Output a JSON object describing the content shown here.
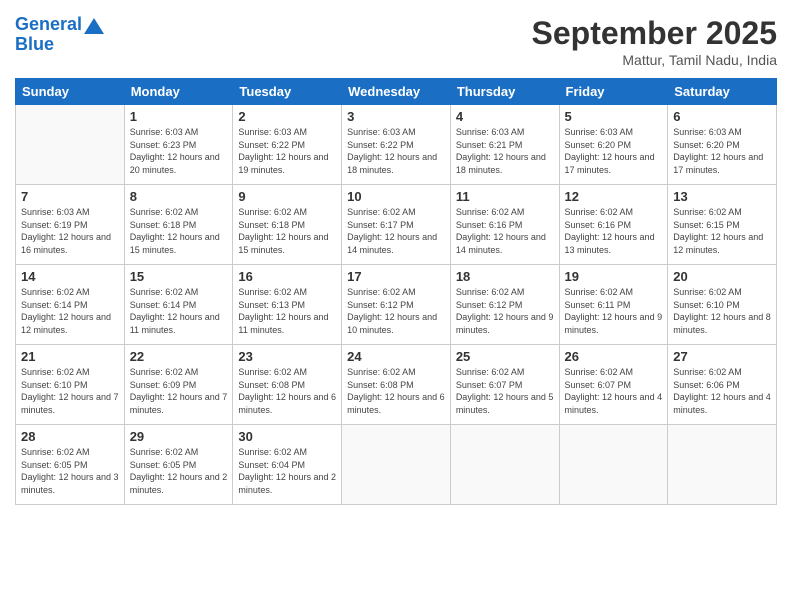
{
  "header": {
    "logo_line1": "General",
    "logo_line2": "Blue",
    "month": "September 2025",
    "location": "Mattur, Tamil Nadu, India"
  },
  "weekdays": [
    "Sunday",
    "Monday",
    "Tuesday",
    "Wednesday",
    "Thursday",
    "Friday",
    "Saturday"
  ],
  "weeks": [
    [
      {
        "day": "",
        "empty": true
      },
      {
        "day": "1",
        "sunrise": "Sunrise: 6:03 AM",
        "sunset": "Sunset: 6:23 PM",
        "daylight": "Daylight: 12 hours and 20 minutes."
      },
      {
        "day": "2",
        "sunrise": "Sunrise: 6:03 AM",
        "sunset": "Sunset: 6:22 PM",
        "daylight": "Daylight: 12 hours and 19 minutes."
      },
      {
        "day": "3",
        "sunrise": "Sunrise: 6:03 AM",
        "sunset": "Sunset: 6:22 PM",
        "daylight": "Daylight: 12 hours and 18 minutes."
      },
      {
        "day": "4",
        "sunrise": "Sunrise: 6:03 AM",
        "sunset": "Sunset: 6:21 PM",
        "daylight": "Daylight: 12 hours and 18 minutes."
      },
      {
        "day": "5",
        "sunrise": "Sunrise: 6:03 AM",
        "sunset": "Sunset: 6:20 PM",
        "daylight": "Daylight: 12 hours and 17 minutes."
      },
      {
        "day": "6",
        "sunrise": "Sunrise: 6:03 AM",
        "sunset": "Sunset: 6:20 PM",
        "daylight": "Daylight: 12 hours and 17 minutes."
      }
    ],
    [
      {
        "day": "7",
        "sunrise": "Sunrise: 6:03 AM",
        "sunset": "Sunset: 6:19 PM",
        "daylight": "Daylight: 12 hours and 16 minutes."
      },
      {
        "day": "8",
        "sunrise": "Sunrise: 6:02 AM",
        "sunset": "Sunset: 6:18 PM",
        "daylight": "Daylight: 12 hours and 15 minutes."
      },
      {
        "day": "9",
        "sunrise": "Sunrise: 6:02 AM",
        "sunset": "Sunset: 6:18 PM",
        "daylight": "Daylight: 12 hours and 15 minutes."
      },
      {
        "day": "10",
        "sunrise": "Sunrise: 6:02 AM",
        "sunset": "Sunset: 6:17 PM",
        "daylight": "Daylight: 12 hours and 14 minutes."
      },
      {
        "day": "11",
        "sunrise": "Sunrise: 6:02 AM",
        "sunset": "Sunset: 6:16 PM",
        "daylight": "Daylight: 12 hours and 14 minutes."
      },
      {
        "day": "12",
        "sunrise": "Sunrise: 6:02 AM",
        "sunset": "Sunset: 6:16 PM",
        "daylight": "Daylight: 12 hours and 13 minutes."
      },
      {
        "day": "13",
        "sunrise": "Sunrise: 6:02 AM",
        "sunset": "Sunset: 6:15 PM",
        "daylight": "Daylight: 12 hours and 12 minutes."
      }
    ],
    [
      {
        "day": "14",
        "sunrise": "Sunrise: 6:02 AM",
        "sunset": "Sunset: 6:14 PM",
        "daylight": "Daylight: 12 hours and 12 minutes."
      },
      {
        "day": "15",
        "sunrise": "Sunrise: 6:02 AM",
        "sunset": "Sunset: 6:14 PM",
        "daylight": "Daylight: 12 hours and 11 minutes."
      },
      {
        "day": "16",
        "sunrise": "Sunrise: 6:02 AM",
        "sunset": "Sunset: 6:13 PM",
        "daylight": "Daylight: 12 hours and 11 minutes."
      },
      {
        "day": "17",
        "sunrise": "Sunrise: 6:02 AM",
        "sunset": "Sunset: 6:12 PM",
        "daylight": "Daylight: 12 hours and 10 minutes."
      },
      {
        "day": "18",
        "sunrise": "Sunrise: 6:02 AM",
        "sunset": "Sunset: 6:12 PM",
        "daylight": "Daylight: 12 hours and 9 minutes."
      },
      {
        "day": "19",
        "sunrise": "Sunrise: 6:02 AM",
        "sunset": "Sunset: 6:11 PM",
        "daylight": "Daylight: 12 hours and 9 minutes."
      },
      {
        "day": "20",
        "sunrise": "Sunrise: 6:02 AM",
        "sunset": "Sunset: 6:10 PM",
        "daylight": "Daylight: 12 hours and 8 minutes."
      }
    ],
    [
      {
        "day": "21",
        "sunrise": "Sunrise: 6:02 AM",
        "sunset": "Sunset: 6:10 PM",
        "daylight": "Daylight: 12 hours and 7 minutes."
      },
      {
        "day": "22",
        "sunrise": "Sunrise: 6:02 AM",
        "sunset": "Sunset: 6:09 PM",
        "daylight": "Daylight: 12 hours and 7 minutes."
      },
      {
        "day": "23",
        "sunrise": "Sunrise: 6:02 AM",
        "sunset": "Sunset: 6:08 PM",
        "daylight": "Daylight: 12 hours and 6 minutes."
      },
      {
        "day": "24",
        "sunrise": "Sunrise: 6:02 AM",
        "sunset": "Sunset: 6:08 PM",
        "daylight": "Daylight: 12 hours and 6 minutes."
      },
      {
        "day": "25",
        "sunrise": "Sunrise: 6:02 AM",
        "sunset": "Sunset: 6:07 PM",
        "daylight": "Daylight: 12 hours and 5 minutes."
      },
      {
        "day": "26",
        "sunrise": "Sunrise: 6:02 AM",
        "sunset": "Sunset: 6:07 PM",
        "daylight": "Daylight: 12 hours and 4 minutes."
      },
      {
        "day": "27",
        "sunrise": "Sunrise: 6:02 AM",
        "sunset": "Sunset: 6:06 PM",
        "daylight": "Daylight: 12 hours and 4 minutes."
      }
    ],
    [
      {
        "day": "28",
        "sunrise": "Sunrise: 6:02 AM",
        "sunset": "Sunset: 6:05 PM",
        "daylight": "Daylight: 12 hours and 3 minutes."
      },
      {
        "day": "29",
        "sunrise": "Sunrise: 6:02 AM",
        "sunset": "Sunset: 6:05 PM",
        "daylight": "Daylight: 12 hours and 2 minutes."
      },
      {
        "day": "30",
        "sunrise": "Sunrise: 6:02 AM",
        "sunset": "Sunset: 6:04 PM",
        "daylight": "Daylight: 12 hours and 2 minutes."
      },
      {
        "day": "",
        "empty": true
      },
      {
        "day": "",
        "empty": true
      },
      {
        "day": "",
        "empty": true
      },
      {
        "day": "",
        "empty": true
      }
    ]
  ]
}
